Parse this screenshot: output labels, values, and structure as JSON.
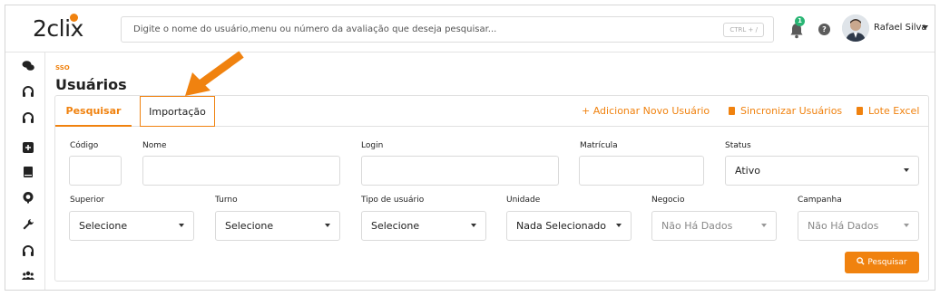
{
  "header": {
    "logo": "2clix",
    "search_placeholder": "Digite o nome do usuário,menu ou número da avaliação que deseja pesquisar...",
    "shortcut": "CTRL + /",
    "notification_count": "1",
    "help": "?",
    "user_name": "Rafael Silva"
  },
  "sidebar": {
    "icons": [
      "chat-icon",
      "headset-icon",
      "headset-icon",
      "plus-square-icon",
      "book-icon",
      "support-icon",
      "wrench-icon",
      "headset-icon",
      "users-icon"
    ]
  },
  "page": {
    "breadcrumb": "SSO",
    "title": "Usuários"
  },
  "tabs": [
    {
      "label": "Pesquisar"
    },
    {
      "label": "Importação"
    }
  ],
  "actions": {
    "add_user": "+ Adicionar Novo Usuário",
    "sync_users": "Sincronizar Usuários",
    "excel_batch": "Lote Excel"
  },
  "filters": {
    "codigo": {
      "label": "Código",
      "value": ""
    },
    "nome": {
      "label": "Nome",
      "value": ""
    },
    "login": {
      "label": "Login",
      "value": ""
    },
    "matricula": {
      "label": "Matrícula",
      "value": ""
    },
    "status": {
      "label": "Status",
      "value": "Ativo"
    },
    "superior": {
      "label": "Superior",
      "value": "Selecione"
    },
    "turno": {
      "label": "Turno",
      "value": "Selecione"
    },
    "tipo_usuario": {
      "label": "Tipo de usuário",
      "value": "Selecione"
    },
    "unidade": {
      "label": "Unidade",
      "value": "Nada Selecionado"
    },
    "negocio": {
      "label": "Negocio",
      "value": "Não Há Dados"
    },
    "campanha": {
      "label": "Campanha",
      "value": "Não Há Dados"
    }
  },
  "search_button": "Pesquisar",
  "colors": {
    "accent": "#f0820f",
    "badge": "#29b574"
  }
}
